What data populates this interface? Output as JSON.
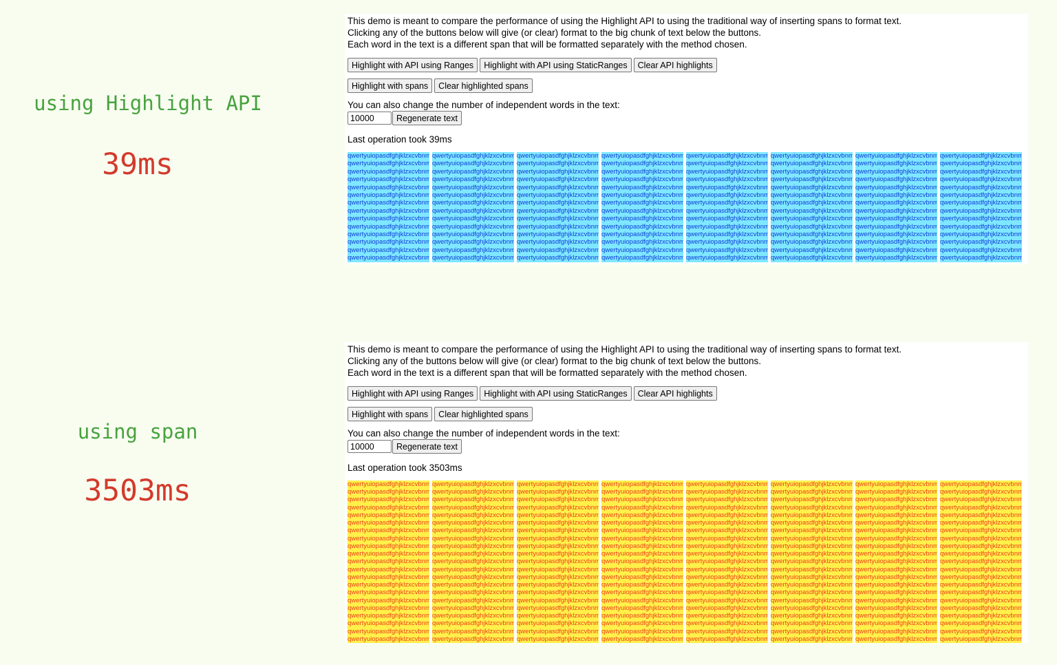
{
  "comparisons": [
    {
      "method_label": "using Highlight API",
      "time_label": "39ms",
      "last_operation": "Last operation took 39ms",
      "highlight_color": "#7fe7ff",
      "text_color": "#0c3bd8",
      "visible_rows": 14
    },
    {
      "method_label": "using span",
      "time_label": "3503ms",
      "last_operation": "Last operation took 3503ms",
      "highlight_color": "#fff04a",
      "text_color": "#ee3d1c",
      "visible_rows": 21
    }
  ],
  "demo": {
    "intro_line1": "This demo is meant to compare the performance of using the Highlight API to using the traditional way of inserting spans to format text.",
    "intro_line2": "Clicking any of the buttons below will give (or clear) format to the big chunk of text below the buttons.",
    "intro_line3": "Each word in the text is a different span that will be formatted separately with the method chosen.",
    "buttons": {
      "highlight_ranges": "Highlight with API using Ranges",
      "highlight_static_ranges": "Highlight with API using StaticRanges",
      "clear_api": "Clear API highlights",
      "highlight_spans": "Highlight with spans",
      "clear_spans": "Clear highlighted spans",
      "regenerate": "Regenerate text"
    },
    "change_words_text": "You can also change the number of independent words in the text:",
    "word_count_value": "10000",
    "word": "qwertyuiopasdfghjklzxcvbnm",
    "words_per_row": 8
  },
  "colors": {
    "page_background": "#f8fdf0",
    "method_label_color": "#48a23f",
    "time_label_color": "#d33a2c"
  }
}
